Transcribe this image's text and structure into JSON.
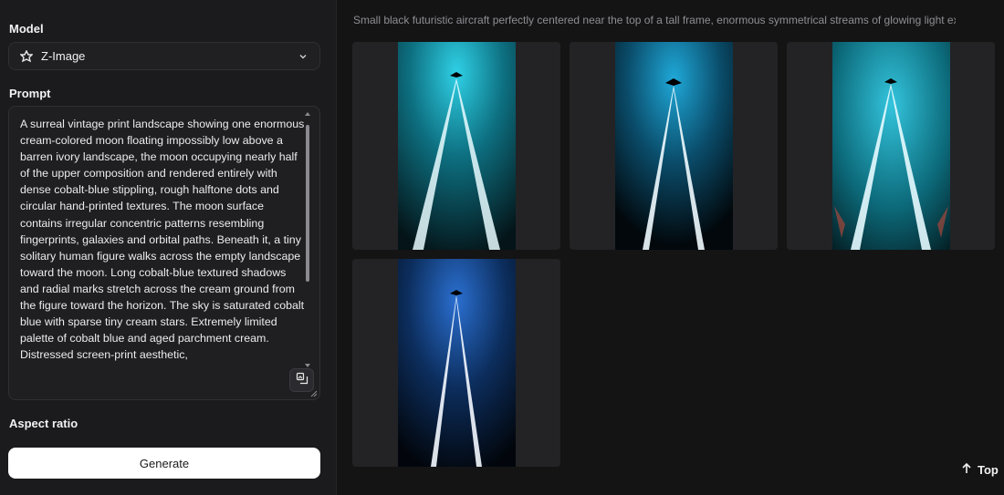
{
  "sidebar": {
    "model_label": "Model",
    "model_value": "Z-Image",
    "prompt_label": "Prompt",
    "prompt_text": "A surreal vintage print landscape showing one enormous cream-colored moon floating impossibly low above a barren ivory landscape, the moon occupying nearly half of the upper composition and rendered entirely with dense cobalt-blue stippling, rough halftone dots and circular hand-printed textures. The moon surface contains irregular concentric patterns resembling fingerprints, galaxies and orbital paths. Beneath it, a tiny solitary human figure walks across the empty landscape toward the moon. Long cobalt-blue textured shadows and radial marks stretch across the cream ground from the figure toward the horizon. The sky is saturated cobalt blue with sparse tiny cream stars. Extremely limited palette of cobalt blue and aged parchment cream. Distressed screen-print aesthetic,",
    "aspect_label": "Aspect ratio",
    "generate_label": "Generate"
  },
  "gallery": {
    "caption": "Small black futuristic aircraft perfectly centered near the top of a tall frame, enormous symmetrical streams of glowing light ex...",
    "top_label": "Top",
    "images": [
      {
        "name": "generated-image-1",
        "glow": "#2fd0e6",
        "bg": "#062e36"
      },
      {
        "name": "generated-image-2",
        "glow": "#1fa8d8",
        "bg": "#05202e"
      },
      {
        "name": "generated-image-3",
        "glow": "#33c4dd",
        "bg": "#073a44"
      },
      {
        "name": "generated-image-4",
        "glow": "#2a6fd0",
        "bg": "#0a1e3c"
      }
    ]
  },
  "colors": {
    "accent_white": "#ffffff",
    "panel": "#1b1b1d",
    "background": "#141415"
  },
  "icons": {
    "model": "model-logo-icon",
    "dropdown": "chevron-down-icon",
    "enhance": "image-enhance-icon",
    "top": "arrow-up-icon"
  }
}
